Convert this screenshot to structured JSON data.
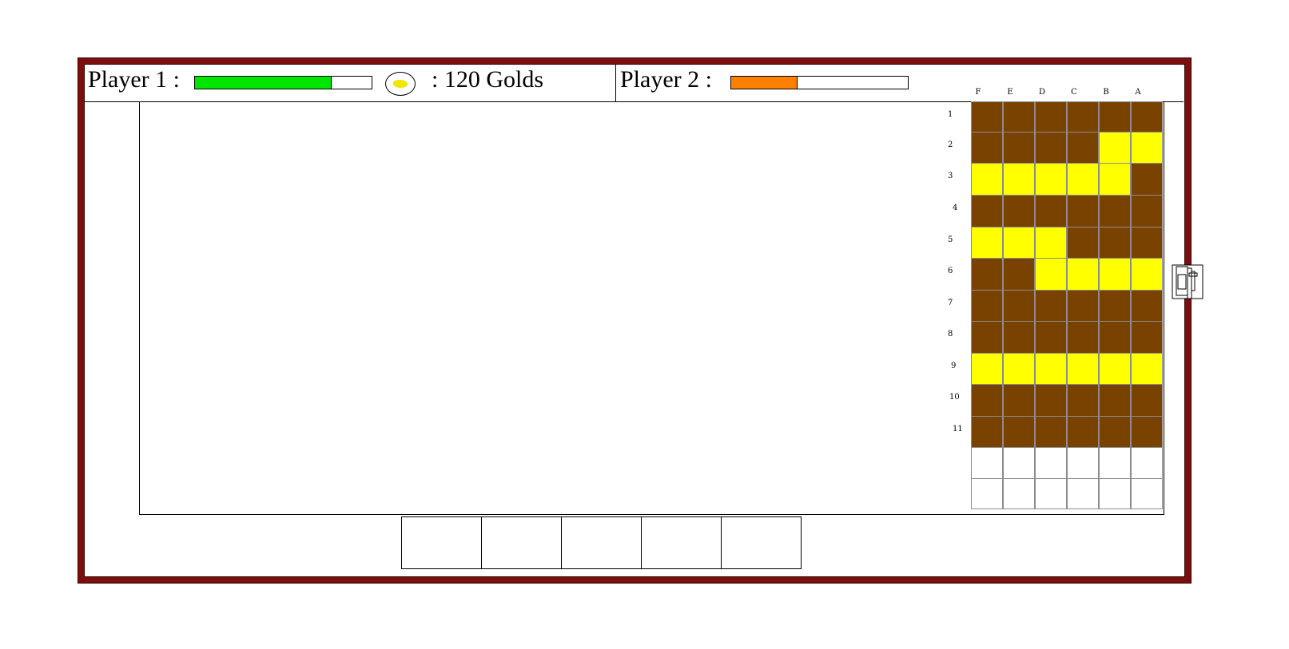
{
  "header": {
    "player1_label": "Player 1 :",
    "player1_health": 0.77,
    "player1_color": "#00e600",
    "gold_icon": "gold-nugget-icon",
    "gold_text": ": 120 Golds",
    "player2_label": "Player 2 :",
    "player2_health": 0.37,
    "player2_color": "#ff8000"
  },
  "board": {
    "columns": [
      "F",
      "E",
      "D",
      "C",
      "B",
      "A"
    ],
    "rows": [
      "1",
      "2",
      "3",
      "4",
      "5",
      "6",
      "7",
      "8",
      "9",
      "10",
      "11"
    ],
    "colors": {
      "B": "#7a4200",
      "Y": "#ffff00",
      "E": "#ffffff"
    },
    "cells": [
      "BBBBBB",
      "BBBBYY",
      "YYYYYB",
      "BBBBBB",
      "YYYBBB",
      "BBYYYY",
      "BBBBBB",
      "BBBBBB",
      "YYYYYY",
      "BBBBBB",
      "BBBBBB",
      "EEEEEE",
      "EEEEEE"
    ]
  },
  "castle_icon": "castle-icon",
  "unit_slots": [
    {},
    {},
    {},
    {},
    {}
  ]
}
